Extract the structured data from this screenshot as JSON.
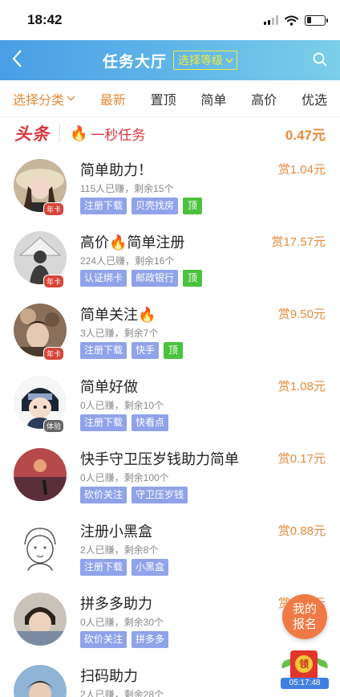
{
  "status_bar": {
    "time": "18:42"
  },
  "nav": {
    "title": "任务大厅",
    "level_button": "选择等级"
  },
  "filters": [
    "选择分类",
    "最新",
    "置顶",
    "简单",
    "高价",
    "优选"
  ],
  "headline": {
    "badge": "头条",
    "text": "一秒任务",
    "price": "0.47元"
  },
  "tasks": [
    {
      "title": "简单助力！",
      "stat": "115人已赚，剩余15个",
      "price": "赏1.04元",
      "tags": [
        "注册下载",
        "贝壳找房"
      ],
      "top_tag": "顶",
      "badge": "年卡"
    },
    {
      "title": "高价",
      "title2": "简单注册",
      "stat": "224人已赚，剩余16个",
      "price": "赏17.57元",
      "tags": [
        "认证绑卡",
        "邮政银行"
      ],
      "top_tag": "顶",
      "badge": "年卡"
    },
    {
      "title": "简单关注",
      "stat": "3人已赚，剩余7个",
      "price": "赏9.50元",
      "tags": [
        "注册下载",
        "快手"
      ],
      "top_tag": "顶",
      "badge": "年卡"
    },
    {
      "title": "简单好做",
      "stat": "0人已赚，剩余10个",
      "price": "赏1.08元",
      "tags": [
        "注册下载",
        "快看点"
      ],
      "badge": "体验"
    },
    {
      "title": "快手守卫压岁钱助力简单",
      "stat": "0人已赚，剩余100个",
      "price": "赏0.17元",
      "tags": [
        "砍价关注",
        "守卫压岁钱"
      ]
    },
    {
      "title": "注册小黑盒",
      "stat": "2人已赚，剩余8个",
      "price": "赏0.88元",
      "tags": [
        "注册下载",
        "小黑盒"
      ]
    },
    {
      "title": "拼多多助力",
      "stat": "0人已赚，剩余30个",
      "price": "赏0.17元",
      "tags": [
        "砍价关注",
        "拼多多"
      ]
    },
    {
      "title": "扫码助力",
      "stat": "2人已赚，剩余28个",
      "price": "赏0.5元",
      "tags": []
    }
  ],
  "floating": {
    "signup_line1": "我的",
    "signup_line2": "报名",
    "packet_label": "领",
    "timer": "05:17:48"
  },
  "colors": {
    "accent": "#e68a3b",
    "nav_start": "#4a9ee6",
    "nav_end": "#7bcfe8",
    "tag": "#8fa3ea",
    "top_tag": "#4cc13e",
    "headline_red": "#d9363e"
  },
  "icons": [
    "back-arrow-icon",
    "search-icon",
    "chevron-down-icon",
    "fire-icon",
    "signal-icon",
    "wifi-icon",
    "battery-icon"
  ]
}
